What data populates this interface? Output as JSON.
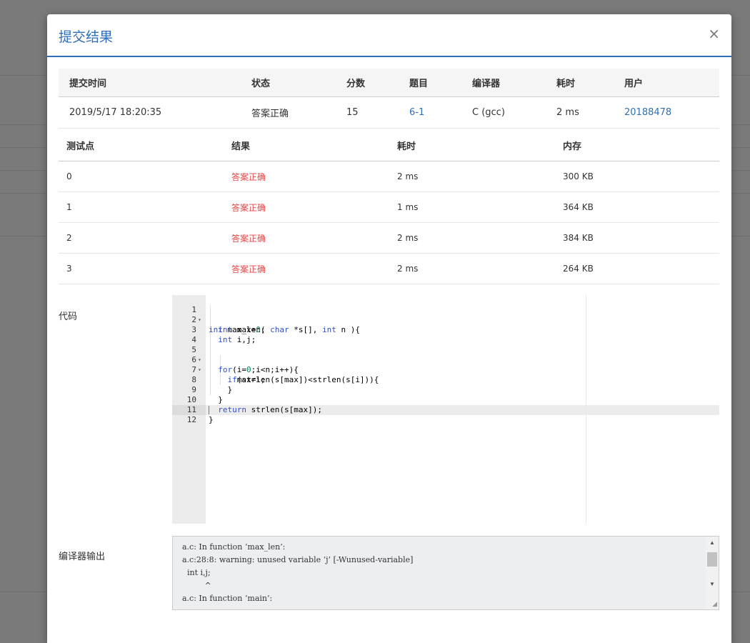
{
  "modal": {
    "title": "提交结果",
    "close_glyph": "×"
  },
  "submission": {
    "headers": [
      "提交时间",
      "状态",
      "分数",
      "题目",
      "编译器",
      "耗时",
      "用户"
    ],
    "row": {
      "time": "2019/5/17 18:20:35",
      "status": "答案正确",
      "score": "15",
      "problem": "6-1",
      "compiler": "C (gcc)",
      "elapsed": "2 ms",
      "user": "20188478"
    }
  },
  "test_cases": {
    "headers": [
      "测试点",
      "结果",
      "耗时",
      "内存"
    ],
    "rows": [
      {
        "id": "0",
        "result": "答案正确",
        "time": "2 ms",
        "memory": "300 KB"
      },
      {
        "id": "1",
        "result": "答案正确",
        "time": "1 ms",
        "memory": "364 KB"
      },
      {
        "id": "2",
        "result": "答案正确",
        "time": "2 ms",
        "memory": "384 KB"
      },
      {
        "id": "3",
        "result": "答案正确",
        "time": "2 ms",
        "memory": "264 KB"
      }
    ]
  },
  "code_section": {
    "label": "代码",
    "lines": [
      "int max_len( char *s[], int n ){",
      "  int max=0;",
      "  int i,j;",
      "",
      "  for(i=0;i<n;i++){",
      "    if(strlen(s[max])<strlen(s[i])){",
      "      max=i;",
      "    }",
      "  }",
      "  return strlen(s[max]);",
      "}",
      ""
    ],
    "line_numbers": [
      "1",
      "2",
      "3",
      "4",
      "5",
      "6",
      "7",
      "8",
      "9",
      "10",
      "11",
      "12"
    ],
    "fold_markers": {
      "1": "▾",
      "5": "▾",
      "6": "▾"
    }
  },
  "compiler_output": {
    "label": "编译器输出",
    "lines": [
      "a.c: In function ‘max_len’:",
      "a.c:28:8: warning: unused variable ‘j’ [-Wunused-variable]",
      "  int i,j;",
      "         ^",
      "a.c: In function ‘main’:"
    ]
  },
  "colors": {
    "accent": "#2f6fb8",
    "status_ok": "#e64545",
    "overlay": "#7a7a7a"
  }
}
